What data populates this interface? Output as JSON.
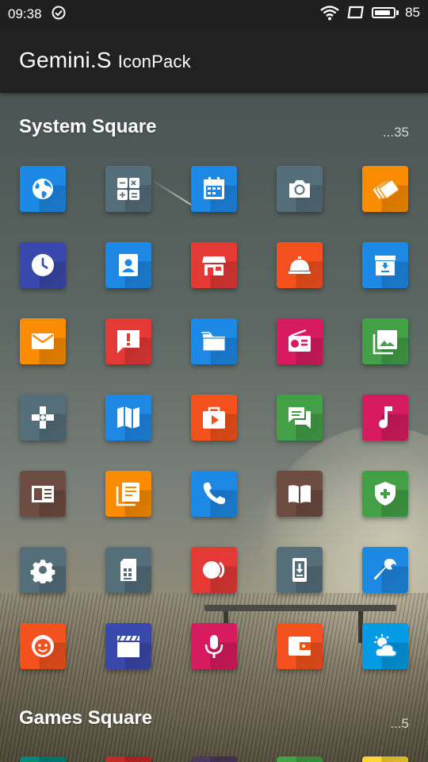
{
  "status_bar": {
    "time": "09:38",
    "battery": "85",
    "battery_level": 0.85
  },
  "app_bar": {
    "title_main": "Gemini.S",
    "title_sub": "IconPack"
  },
  "sections": [
    {
      "title": "System Square",
      "count": "...35"
    },
    {
      "title": "Games Square",
      "count": "...5"
    }
  ],
  "icons": [
    {
      "name": "browser-icon",
      "color": "#1e88e5"
    },
    {
      "name": "calculator-icon",
      "color": "#546e7a"
    },
    {
      "name": "calendar-icon",
      "color": "#1e88e5"
    },
    {
      "name": "camera-icon",
      "color": "#546e7a"
    },
    {
      "name": "cards-icon",
      "color": "#fb8c00"
    },
    {
      "name": "clock-icon",
      "color": "#3949ab"
    },
    {
      "name": "contacts-icon",
      "color": "#1e88e5"
    },
    {
      "name": "store-icon",
      "color": "#e53935"
    },
    {
      "name": "service-bell-icon",
      "color": "#f4511e"
    },
    {
      "name": "archive-icon",
      "color": "#1e88e5"
    },
    {
      "name": "mail-icon",
      "color": "#fb8c00"
    },
    {
      "name": "feedback-icon",
      "color": "#e53935"
    },
    {
      "name": "folder-icon",
      "color": "#1e88e5"
    },
    {
      "name": "radio-icon",
      "color": "#d81b60"
    },
    {
      "name": "gallery-icon",
      "color": "#43a047"
    },
    {
      "name": "gamepad-icon",
      "color": "#546e7a"
    },
    {
      "name": "map-icon",
      "color": "#1e88e5"
    },
    {
      "name": "video-player-icon",
      "color": "#f4511e"
    },
    {
      "name": "chat-icon",
      "color": "#43a047"
    },
    {
      "name": "music-icon",
      "color": "#d81b60"
    },
    {
      "name": "news-icon",
      "color": "#6d4c41"
    },
    {
      "name": "notes-icon",
      "color": "#fb8c00"
    },
    {
      "name": "phone-icon",
      "color": "#1e88e5"
    },
    {
      "name": "book-icon",
      "color": "#6d4c41"
    },
    {
      "name": "security-icon",
      "color": "#43a047"
    },
    {
      "name": "settings-icon",
      "color": "#546e7a"
    },
    {
      "name": "sim-card-icon",
      "color": "#546e7a"
    },
    {
      "name": "toggle-icon",
      "color": "#e53935"
    },
    {
      "name": "phone-download-icon",
      "color": "#546e7a"
    },
    {
      "name": "tools-icon",
      "color": "#1e88e5"
    },
    {
      "name": "face-icon",
      "color": "#f4511e"
    },
    {
      "name": "video-clapper-icon",
      "color": "#3949ab"
    },
    {
      "name": "microphone-icon",
      "color": "#d81b60"
    },
    {
      "name": "wallet-icon",
      "color": "#f4511e"
    },
    {
      "name": "weather-icon",
      "color": "#039be5"
    }
  ],
  "games_icons": [
    {
      "name": "game-icon",
      "color": "#00897b"
    },
    {
      "name": "game-icon",
      "color": "#c62828"
    },
    {
      "name": "game-icon",
      "color": "#4a3a5a"
    },
    {
      "name": "game-icon",
      "color": "#43a047"
    },
    {
      "name": "game-icon",
      "color": "#fdd835"
    }
  ]
}
